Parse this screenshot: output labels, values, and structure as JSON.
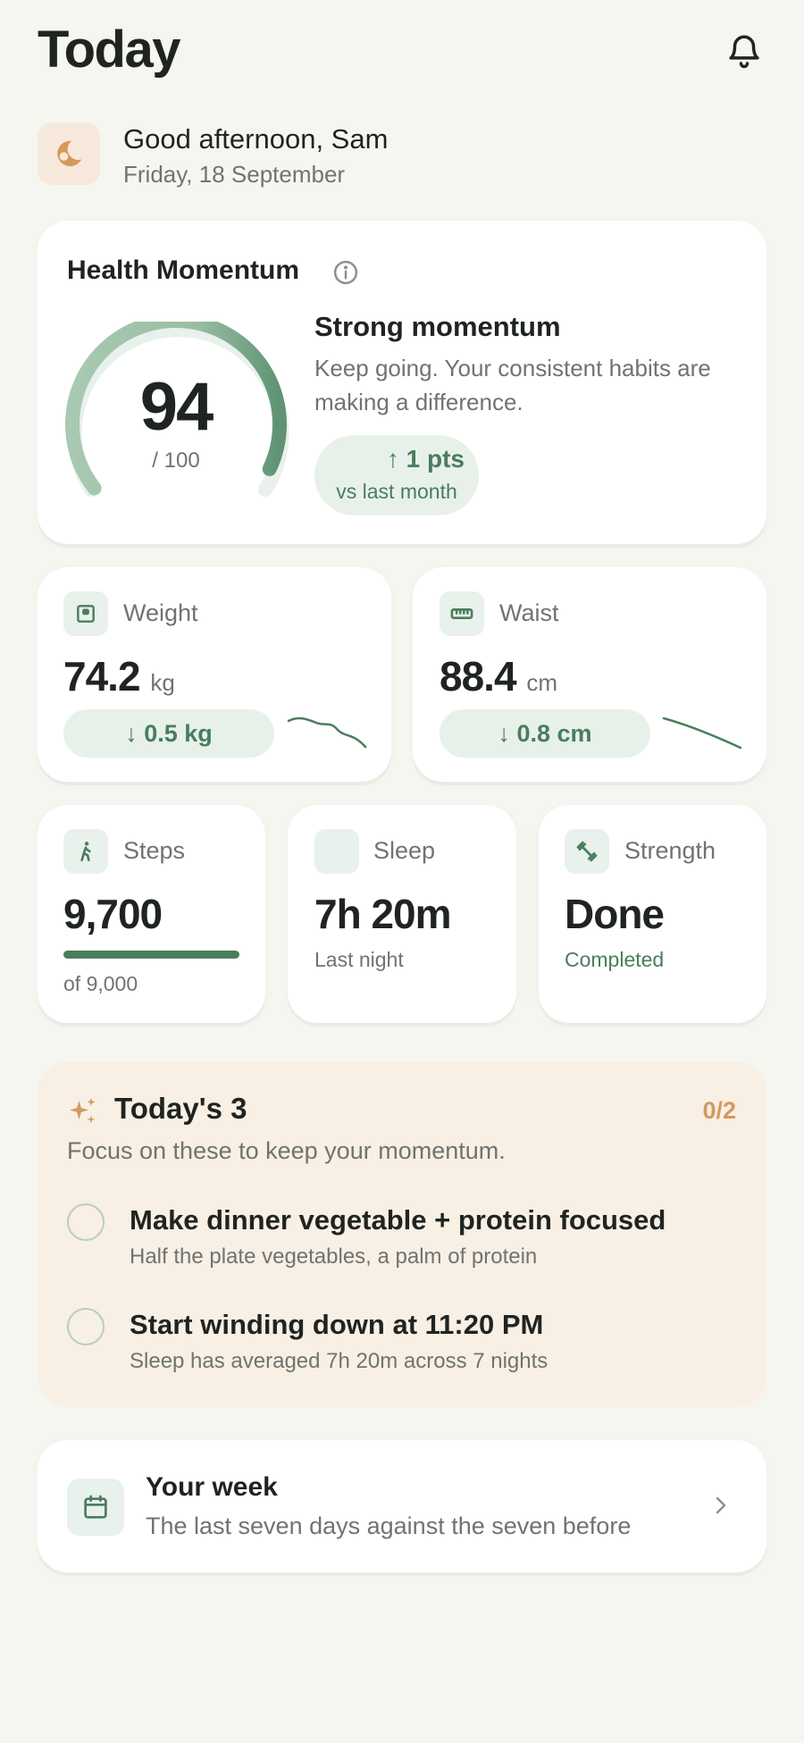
{
  "header": {
    "title": "Today",
    "icons": {
      "notifications": "bell-icon"
    }
  },
  "greeting": {
    "title": "Good afternoon, Sam",
    "date": "Friday, 18 September",
    "icon": "moon-icon"
  },
  "health_momentum": {
    "title": "Health Momentum",
    "score": "94",
    "score_max": "/ 100",
    "score_fraction": 0.94,
    "status_title": "Strong momentum",
    "status_desc": "Keep going. Your consistent habits are making a difference.",
    "trend_value": "↑ 1 pts",
    "trend_label": "vs last month"
  },
  "metrics": {
    "weight": {
      "label": "Weight",
      "value": "74.2",
      "unit": "kg",
      "change": "↓ 0.5 kg",
      "icon": "scale-icon"
    },
    "waist": {
      "label": "Waist",
      "value": "88.4",
      "unit": "cm",
      "change": "↓ 0.8 cm",
      "icon": "ruler-icon"
    }
  },
  "activity": {
    "steps": {
      "label": "Steps",
      "value": "9,700",
      "sub": "of 9,000",
      "progress_fraction": 1.0,
      "icon": "walking-icon"
    },
    "sleep": {
      "label": "Sleep",
      "value": "7h 20m",
      "sub": "Last night",
      "icon": "moon-icon"
    },
    "strength": {
      "label": "Strength",
      "value": "Done",
      "sub": "Completed",
      "icon": "dumbbell-icon"
    }
  },
  "focus": {
    "title": "Today's 3",
    "count": "0/2",
    "desc": "Focus on these to keep your momentum.",
    "tasks": [
      {
        "title": "Make dinner vegetable + protein focused",
        "sub": "Half the plate vegetables, a palm of protein"
      },
      {
        "title": "Start winding down at 11:20 PM",
        "sub": "Sleep has averaged 7h 20m across 7 nights"
      }
    ]
  },
  "week": {
    "title": "Your week",
    "sub": "The last seven days against the seven before"
  },
  "colors": {
    "accent": "#4a7d5d",
    "accent_light": "#e7f1ea",
    "warm": "#d49a5b",
    "warm_bg": "#f8efe5",
    "bg": "#f6f6f1"
  }
}
